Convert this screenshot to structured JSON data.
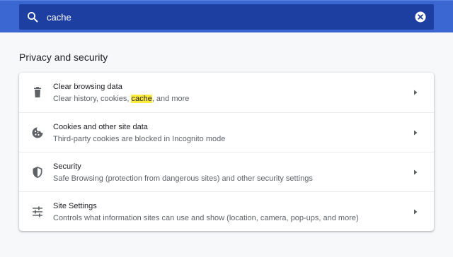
{
  "search": {
    "value": "cache",
    "icon": "search-icon",
    "clear_icon": "clear-search-icon"
  },
  "section": {
    "title": "Privacy and security"
  },
  "rows": [
    {
      "icon": "trash-icon",
      "title": "Clear browsing data",
      "sub_before": "Clear history, cookies, ",
      "sub_highlight": "cache",
      "sub_after": ", and more"
    },
    {
      "icon": "cookie-icon",
      "title": "Cookies and other site data",
      "sub": "Third-party cookies are blocked in Incognito mode"
    },
    {
      "icon": "shield-icon",
      "title": "Security",
      "sub": "Safe Browsing (protection from dangerous sites) and other security settings"
    },
    {
      "icon": "tune-icon",
      "title": "Site Settings",
      "sub": "Controls what information sites can use and show (location, camera, pop-ups, and more)"
    }
  ],
  "colors": {
    "header": "#3a67d1",
    "search_box": "#1e3fa2",
    "highlight": "#ffeb3b",
    "background": "#f7f8fa"
  }
}
